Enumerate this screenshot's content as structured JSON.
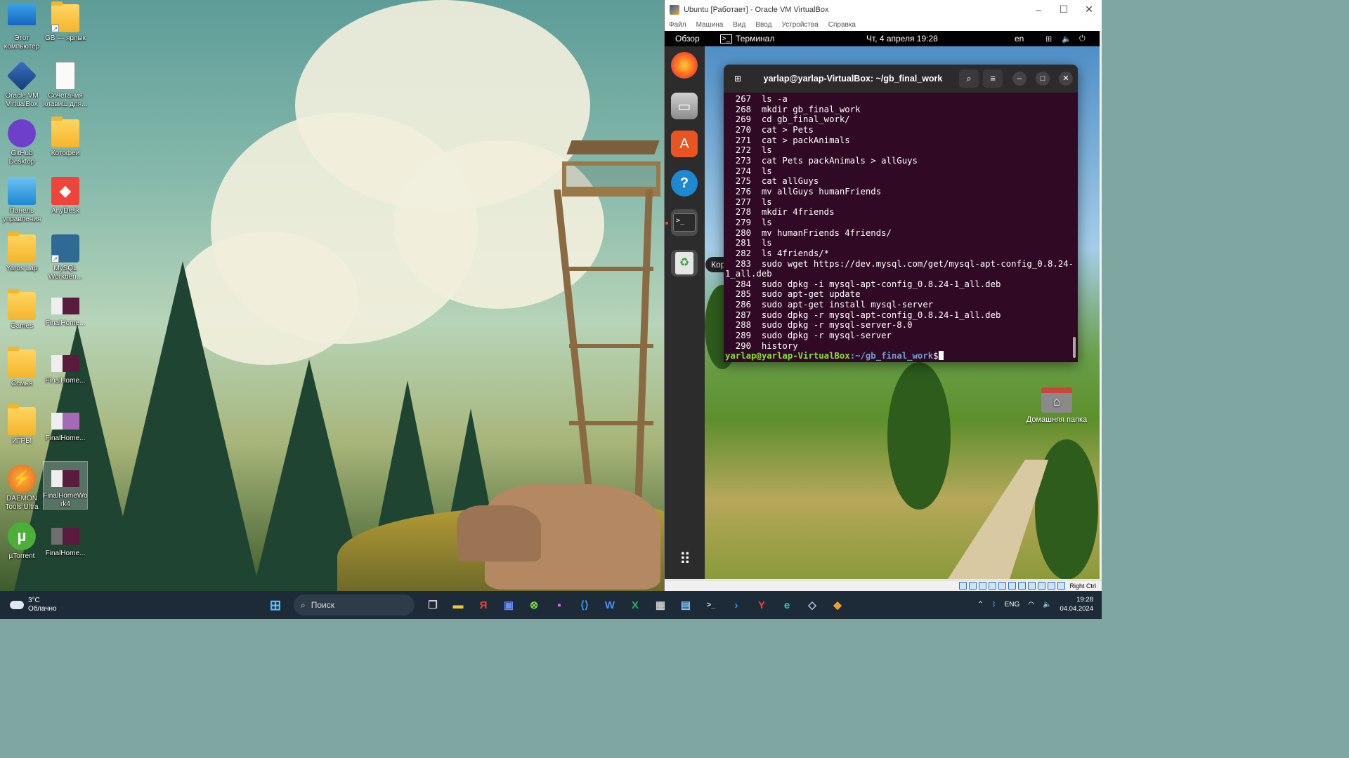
{
  "desktop": {
    "icons": [
      {
        "label": "Этот компьютер",
        "icon": "computer-icon"
      },
      {
        "label": "GB — ярлык",
        "icon": "folder-icon"
      },
      {
        "label": "Oracle VM VirtualBox",
        "icon": "virtualbox-icon"
      },
      {
        "label": "Сочетания клавиш для...",
        "icon": "document-icon"
      },
      {
        "label": "GitHub Desktop",
        "icon": "github-icon"
      },
      {
        "label": "Котофеи",
        "icon": "folder-icon"
      },
      {
        "label": "Панель управления",
        "icon": "control-panel-icon"
      },
      {
        "label": "AnyDesk",
        "icon": "anydesk-icon"
      },
      {
        "label": "Yaros Lap",
        "icon": "folder-icon"
      },
      {
        "label": "MySQL Workben...",
        "icon": "mysql-icon"
      },
      {
        "label": "Games",
        "icon": "folder-icon"
      },
      {
        "label": "FinalHome...",
        "icon": "image-file-icon"
      },
      {
        "label": "Семья",
        "icon": "folder-icon"
      },
      {
        "label": "FinalHome...",
        "icon": "image-file-icon"
      },
      {
        "label": "ИГРЫ",
        "icon": "folder-icon"
      },
      {
        "label": "FinalHome...",
        "icon": "image-file-icon"
      },
      {
        "label": "DAEMON Tools Ultra",
        "icon": "daemon-tools-icon"
      },
      {
        "label": "FinalHomeWork4",
        "icon": "image-file-icon"
      },
      {
        "label": "µTorrent",
        "icon": "utorrent-icon"
      },
      {
        "label": "FinalHome...",
        "icon": "image-file-icon"
      }
    ]
  },
  "vbox": {
    "title": "Ubuntu [Работает] - Oracle VM VirtualBox",
    "menu": [
      "Файл",
      "Машина",
      "Вид",
      "Ввод",
      "Устройства",
      "Справка"
    ],
    "host_key": "Right Ctrl"
  },
  "gnome": {
    "overview": "Обзор",
    "active_app": "Терминал",
    "clock": "Чт, 4 апреля  19:28",
    "lang": "en",
    "dock_tooltip": "Корзина",
    "home_folder": "Домашняя папка"
  },
  "terminal": {
    "title": "yarlap@yarlap-VirtualBox: ~/gb_final_work",
    "lines": [
      "  267  ls -a",
      "  268  mkdir gb_final_work",
      "  269  cd gb_final_work/",
      "  270  cat > Pets",
      "  271  cat > packAnimals",
      "  272  ls",
      "  273  cat Pets packAnimals > allGuys",
      "  274  ls",
      "  275  cat allGuys",
      "  276  mv allGuys humanFriends",
      "  277  ls",
      "  278  mkdir 4friends",
      "  279  ls",
      "  280  mv humanFriends 4friends/",
      "  281  ls",
      "  282  ls 4friends/*",
      "  283  sudo wget https://dev.mysql.com/get/mysql-apt-config_0.8.24-",
      "1_all.deb",
      "  284  sudo dpkg -i mysql-apt-config_0.8.24-1_all.deb",
      "  285  sudo apt-get update",
      "  286  sudo apt-get install mysql-server",
      "  287  sudo dpkg -r mysql-apt-config_0.8.24-1_all.deb",
      "  288  sudo dpkg -r mysql-server-8.0",
      "  289  sudo dpkg -r mysql-server",
      "  290  history"
    ],
    "prompt_user": "yarlap@yarlap-VirtualBox",
    "prompt_path": ":~/gb_final_work",
    "prompt_symbol": "$"
  },
  "taskbar": {
    "weather_temp": "3°C",
    "weather_desc": "Облачно",
    "search_placeholder": "Поиск",
    "lang": "ENG",
    "time": "19:28",
    "date": "04.04.2024"
  }
}
